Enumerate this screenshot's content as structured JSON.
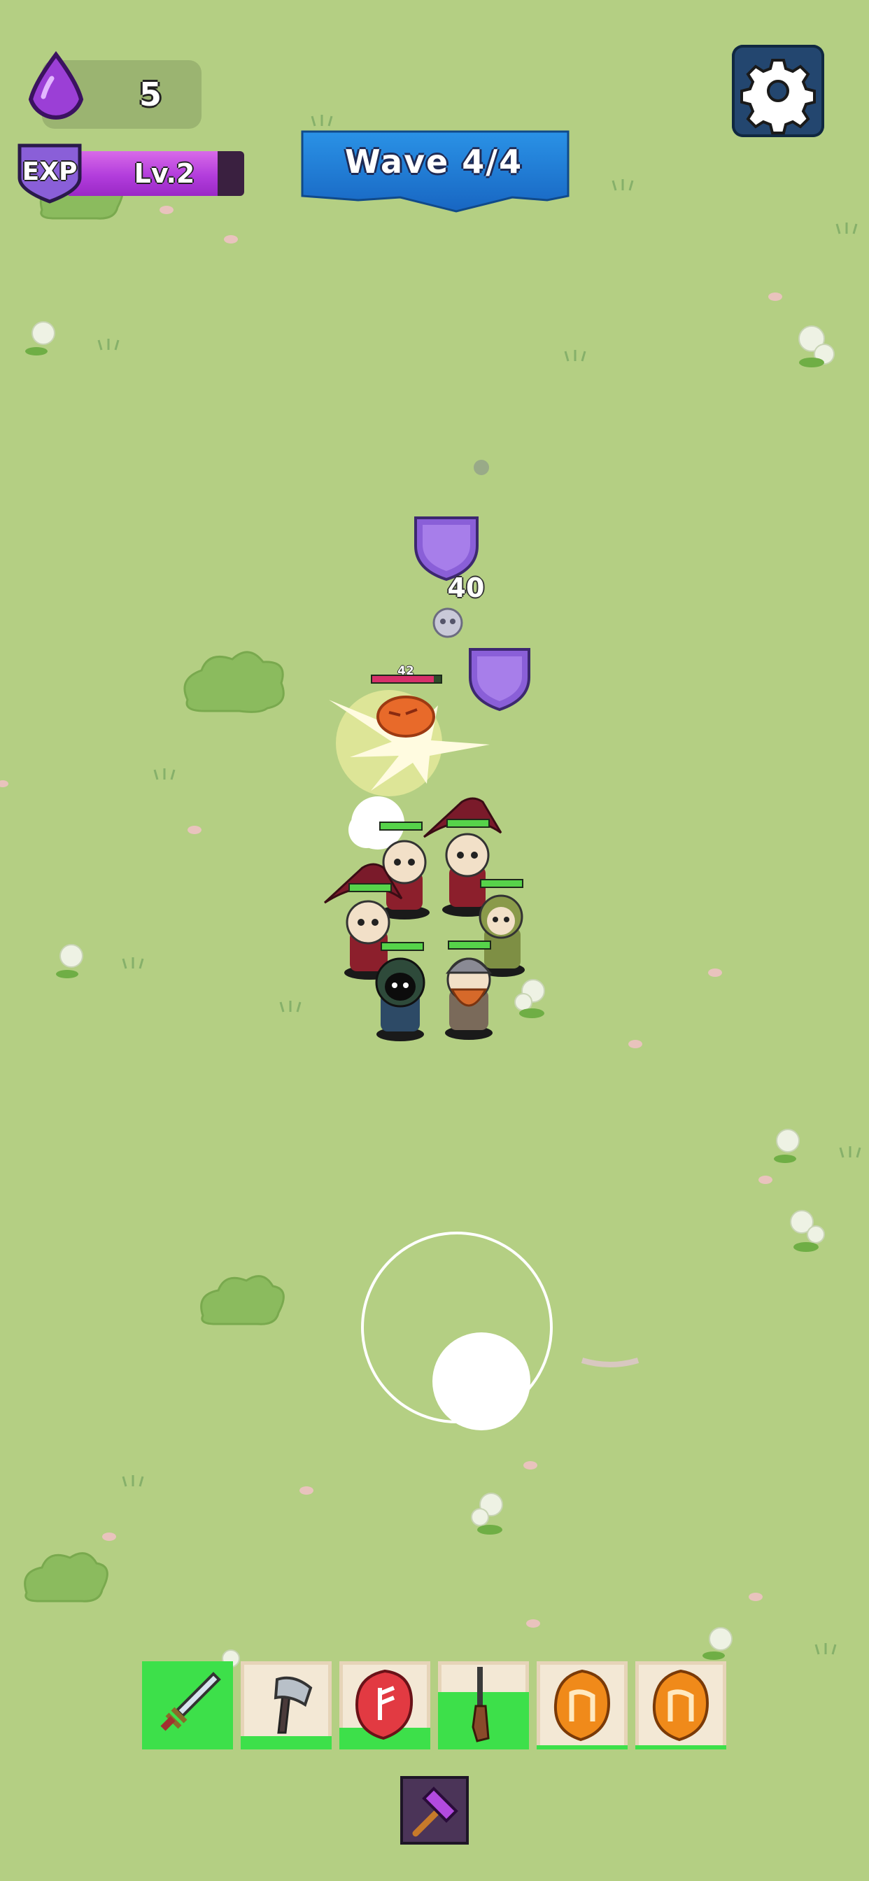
{
  "hud": {
    "gem_count": "5",
    "exp_label": "EXP",
    "level_label": "Lv.2",
    "exp_progress": 0.85,
    "settings_icon": "gear-icon",
    "gem_icon": "purple-drop-icon"
  },
  "wave": {
    "label": "Wave 4/4"
  },
  "battle": {
    "damage_number": "40",
    "enemy_hp_label": "42",
    "heroes": [
      "wizard",
      "wizard",
      "wizard",
      "archer",
      "hooded-rogue",
      "viking"
    ]
  },
  "skills": {
    "slots": [
      {
        "icon": "sword-icon",
        "cooldown_fill": 1.0
      },
      {
        "icon": "axe-icon",
        "cooldown_fill": 0.15
      },
      {
        "icon": "red-rune-icon",
        "cooldown_fill": 0.25
      },
      {
        "icon": "rifle-icon",
        "cooldown_fill": 0.65
      },
      {
        "icon": "orange-rune-icon",
        "cooldown_fill": 0.05
      },
      {
        "icon": "orange-rune-icon",
        "cooldown_fill": 0.05
      }
    ],
    "special_icon": "purple-hammer-icon"
  },
  "colors": {
    "grass": "#b4cf83",
    "bush": "#8bbb5e",
    "active": "#3de04a",
    "wave_banner": "#1b7fd3"
  }
}
